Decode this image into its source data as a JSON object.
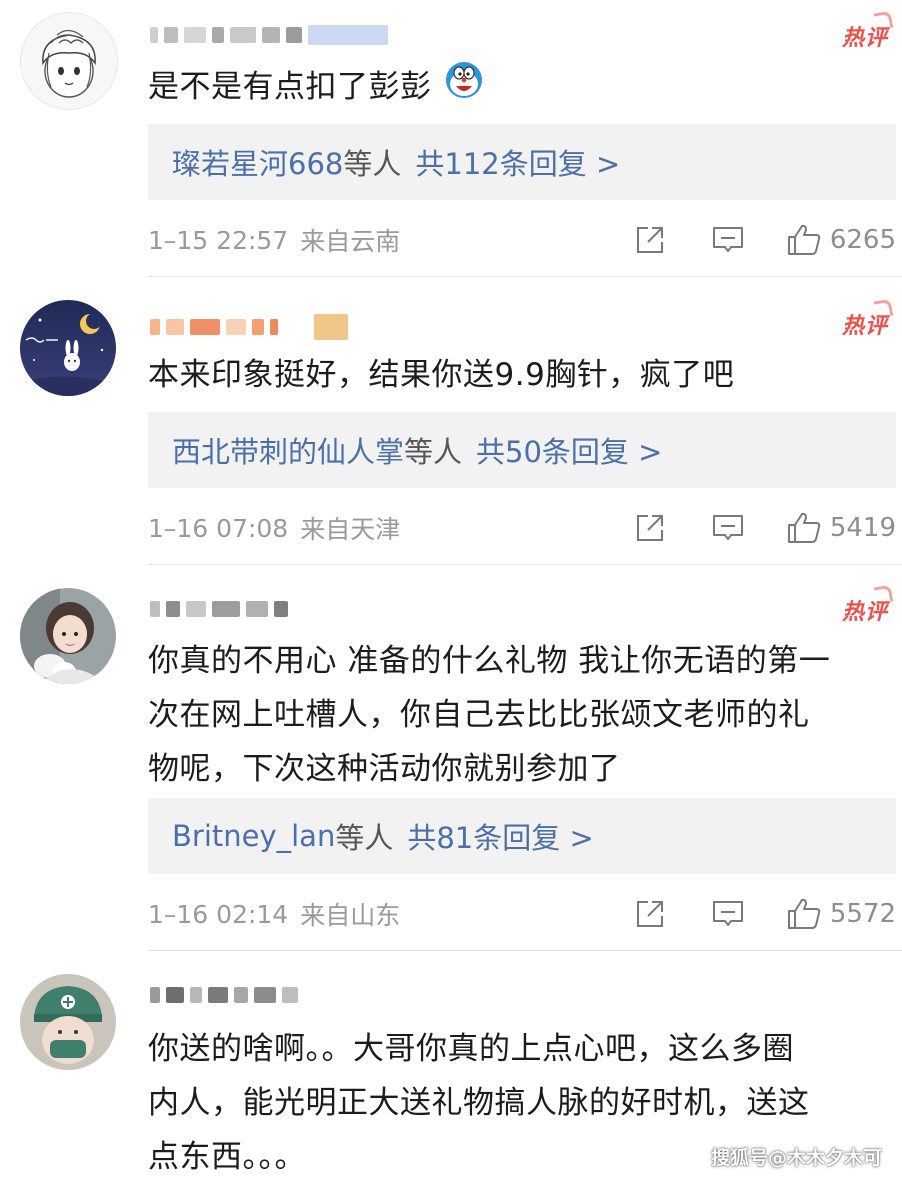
{
  "comments": [
    {
      "body": "是不是有点扣了彭彭",
      "emoji": "doraemon-emoji",
      "hot_label": "热评",
      "reply_users": "璨若星河668",
      "reply_suffix": "等人",
      "reply_count": "共112条回复 >",
      "time": "1–15 22:57",
      "location": "来自云南",
      "likes": "6265"
    },
    {
      "body": "本来印象挺好，结果你送9.9胸针，疯了吧",
      "hot_label": "热评",
      "reply_users": "西北带刺的仙人掌",
      "reply_suffix": "等人",
      "reply_count": "共50条回复 >",
      "time": "1–16 07:08",
      "location": "来自天津",
      "likes": "5419"
    },
    {
      "body_lines": [
        "你真的不用心 准备的什么礼物 我让你无语的第一",
        "次在网上吐槽人，你自己去比比张颂文老师的礼",
        "物呢，下次这种活动你就别参加了"
      ],
      "hot_label": "热评",
      "reply_users": "Britney_lan",
      "reply_suffix": "等人",
      "reply_count": "共81条回复 >",
      "time": "1–16 02:14",
      "location": "来自山东",
      "likes": "5572"
    },
    {
      "body_lines": [
        "你送的啥啊。。大哥你真的上点心吧，这么多圈",
        "内人，能光明正大送礼物搞人脉的好时机，送这",
        "点东西。。。"
      ]
    }
  ],
  "icons": {
    "share": "share-icon",
    "comment": "comment-icon",
    "like": "thumbs-up-icon"
  },
  "colors": {
    "link_blue": "#4b6fab",
    "hot_red": "#f0504a",
    "reply_bg": "#f2f2f2",
    "meta_gray": "#9a9a9a"
  },
  "watermark": "搜狐号@木木夕木可"
}
